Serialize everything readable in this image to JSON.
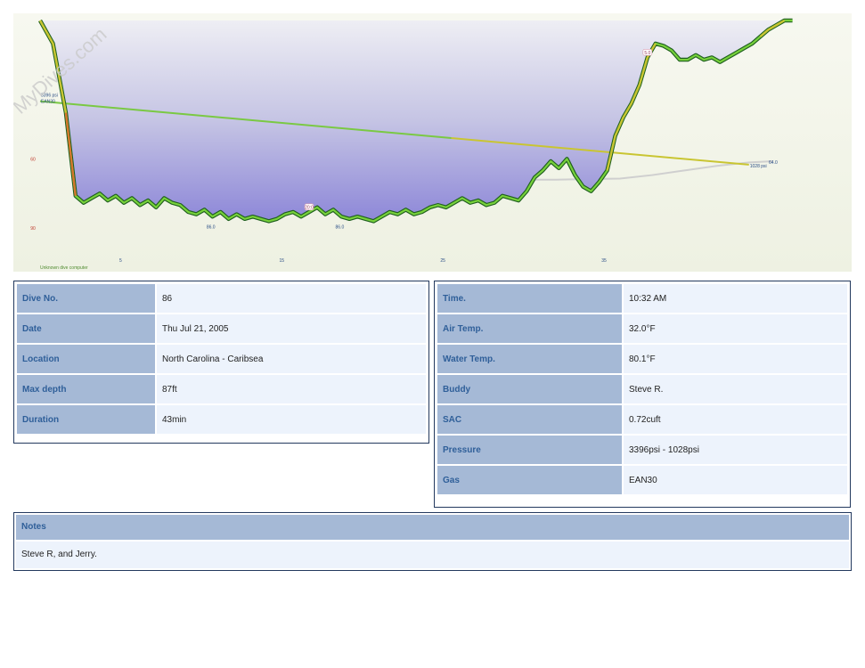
{
  "chart_data": {
    "type": "area",
    "watermark": "MyDives.com",
    "dive_computer_label": "Unknown dive computer",
    "xlim": [
      0,
      47
    ],
    "ylim": [
      0,
      105
    ],
    "x_ticks": [
      {
        "value": 5,
        "label": "5"
      },
      {
        "value": 15,
        "label": "15"
      },
      {
        "value": 25,
        "label": "25"
      },
      {
        "value": 35,
        "label": "35"
      }
    ],
    "y_ticks": [
      {
        "value": 60,
        "label": "60"
      },
      {
        "value": 90,
        "label": "90"
      }
    ],
    "depth_profile": [
      [
        0,
        0
      ],
      [
        0.8,
        10
      ],
      [
        1.6,
        40
      ],
      [
        2.2,
        76
      ],
      [
        2.7,
        79
      ],
      [
        3.2,
        77
      ],
      [
        3.7,
        75
      ],
      [
        4.2,
        78
      ],
      [
        4.7,
        76
      ],
      [
        5.2,
        79
      ],
      [
        5.7,
        77
      ],
      [
        6.2,
        80
      ],
      [
        6.7,
        78
      ],
      [
        7.2,
        81
      ],
      [
        7.7,
        77
      ],
      [
        8.2,
        79
      ],
      [
        8.7,
        80
      ],
      [
        9.2,
        83
      ],
      [
        9.7,
        84
      ],
      [
        10.2,
        82
      ],
      [
        10.7,
        85
      ],
      [
        11.2,
        83
      ],
      [
        11.7,
        86
      ],
      [
        12.2,
        84
      ],
      [
        12.7,
        86
      ],
      [
        13.2,
        85
      ],
      [
        13.7,
        86
      ],
      [
        14.2,
        87
      ],
      [
        14.7,
        86
      ],
      [
        15.2,
        84
      ],
      [
        15.7,
        83
      ],
      [
        16.2,
        85
      ],
      [
        16.7,
        83
      ],
      [
        17.2,
        81
      ],
      [
        17.7,
        84
      ],
      [
        18.2,
        82
      ],
      [
        18.7,
        85
      ],
      [
        19.2,
        86
      ],
      [
        19.7,
        85
      ],
      [
        20.2,
        86
      ],
      [
        20.7,
        87
      ],
      [
        21.2,
        85
      ],
      [
        21.7,
        83
      ],
      [
        22.2,
        84
      ],
      [
        22.7,
        82
      ],
      [
        23.2,
        84
      ],
      [
        23.7,
        83
      ],
      [
        24.2,
        81
      ],
      [
        24.7,
        80
      ],
      [
        25.2,
        81
      ],
      [
        25.7,
        79
      ],
      [
        26.2,
        77
      ],
      [
        26.7,
        79
      ],
      [
        27.2,
        78
      ],
      [
        27.7,
        80
      ],
      [
        28.2,
        79
      ],
      [
        28.7,
        76
      ],
      [
        29.2,
        77
      ],
      [
        29.7,
        78
      ],
      [
        30.2,
        74
      ],
      [
        30.7,
        68
      ],
      [
        31.2,
        65
      ],
      [
        31.7,
        61
      ],
      [
        32.2,
        64
      ],
      [
        32.7,
        60
      ],
      [
        33.2,
        67
      ],
      [
        33.7,
        72
      ],
      [
        34.2,
        74
      ],
      [
        34.7,
        70
      ],
      [
        35.2,
        65
      ],
      [
        35.7,
        50
      ],
      [
        36.2,
        42
      ],
      [
        36.7,
        36
      ],
      [
        37.2,
        28
      ],
      [
        37.7,
        16
      ],
      [
        38.2,
        10
      ],
      [
        38.7,
        11
      ],
      [
        39.2,
        13
      ],
      [
        39.7,
        17
      ],
      [
        40.2,
        17
      ],
      [
        40.7,
        15
      ],
      [
        41.2,
        17
      ],
      [
        41.7,
        16
      ],
      [
        42.2,
        18
      ],
      [
        42.7,
        16
      ],
      [
        43.2,
        14
      ],
      [
        43.7,
        12
      ],
      [
        44.2,
        10
      ],
      [
        44.7,
        7
      ],
      [
        45.2,
        4
      ],
      [
        45.7,
        2
      ],
      [
        46.2,
        0
      ],
      [
        46.7,
        0
      ]
    ],
    "ascent_rate_warnings": [
      [
        0,
        1.6
      ],
      [
        1.6,
        2.2
      ],
      [
        35.2,
        38.2
      ],
      [
        44.7,
        46.2
      ]
    ],
    "tank_pressure": {
      "start": {
        "x": 0,
        "depth": 35,
        "psi": 3396,
        "label": "3396 psi"
      },
      "end": {
        "x": 44,
        "depth": 62.5,
        "psi": 1028,
        "label": "1028 psi"
      },
      "gas_label": "EAN30"
    },
    "ceiling_curve": [
      [
        1.5,
        25
      ],
      [
        3,
        40
      ],
      [
        5,
        50
      ],
      [
        8,
        57
      ],
      [
        12,
        62
      ],
      [
        16,
        65
      ],
      [
        20,
        67
      ],
      [
        24,
        68
      ],
      [
        28,
        69
      ],
      [
        30,
        69
      ],
      [
        32,
        69
      ],
      [
        36,
        68.5
      ],
      [
        38,
        67
      ],
      [
        40,
        65
      ],
      [
        42,
        63
      ],
      [
        44,
        61.5
      ],
      [
        45.5,
        61
      ]
    ],
    "annotations": [
      {
        "x": 10.6,
        "depth": 89,
        "text": "86.0",
        "kind": "depth-label"
      },
      {
        "x": 18.6,
        "depth": 89,
        "text": "86.0",
        "kind": "depth-label"
      },
      {
        "x": 16.7,
        "depth": 81,
        "text": "20:0",
        "kind": "badge"
      },
      {
        "x": 37.7,
        "depth": 14,
        "text": "5.0",
        "kind": "badge"
      },
      {
        "x": 45.5,
        "depth": 61,
        "text": "64.0",
        "kind": "end-label"
      }
    ]
  },
  "table_left": {
    "rows": [
      {
        "key": "Dive No.",
        "value": "86"
      },
      {
        "key": "Date",
        "value": "Thu Jul 21, 2005"
      },
      {
        "key": "Location",
        "value": "North Carolina - Caribsea"
      },
      {
        "key": "Max depth",
        "value": "87ft"
      },
      {
        "key": "Duration",
        "value": "43min"
      }
    ]
  },
  "table_right": {
    "rows": [
      {
        "key": "Time.",
        "value": "10:32 AM"
      },
      {
        "key": "Air Temp.",
        "value": "32.0°F"
      },
      {
        "key": "Water Temp.",
        "value": "80.1°F"
      },
      {
        "key": "Buddy",
        "value": "Steve R."
      },
      {
        "key": "SAC",
        "value": "0.72cuft"
      },
      {
        "key": "Pressure",
        "value": "3396psi - 1028psi"
      },
      {
        "key": "Gas",
        "value": "EAN30"
      }
    ]
  },
  "notes": {
    "label": "Notes",
    "text": "Steve R, and Jerry."
  }
}
